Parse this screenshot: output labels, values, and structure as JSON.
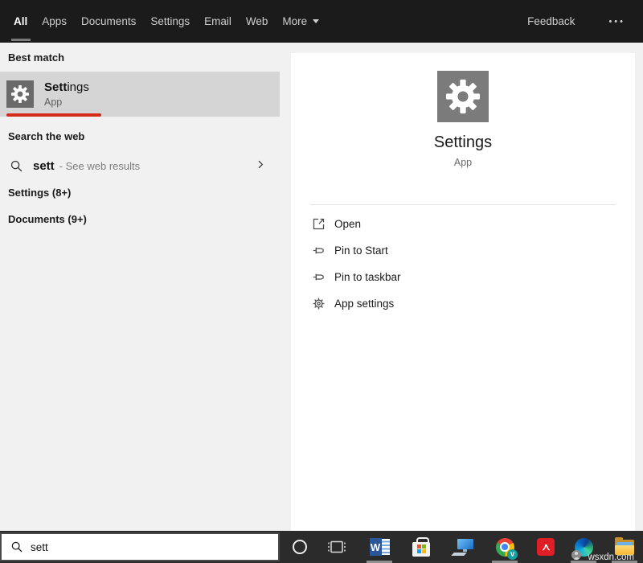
{
  "topbar": {
    "tabs": [
      {
        "label": "All",
        "active": true
      },
      {
        "label": "Apps",
        "active": false
      },
      {
        "label": "Documents",
        "active": false
      },
      {
        "label": "Settings",
        "active": false
      },
      {
        "label": "Email",
        "active": false
      },
      {
        "label": "Web",
        "active": false
      }
    ],
    "more_label": "More",
    "feedback_label": "Feedback",
    "overflow_label": "•••"
  },
  "left_panel": {
    "best_match_header": "Best match",
    "best_match": {
      "title_match": "Sett",
      "title_rest": "ings",
      "subtitle": "App"
    },
    "search_web_header": "Search the web",
    "web_suggestion": {
      "query": "sett",
      "suffix": "- See web results"
    },
    "groups": [
      {
        "label": "Settings (8+)"
      },
      {
        "label": "Documents (9+)"
      }
    ]
  },
  "preview_pane": {
    "app_title": "Settings",
    "app_subtitle": "App",
    "actions": [
      {
        "label": "Open",
        "icon": "open-icon"
      },
      {
        "label": "Pin to Start",
        "icon": "pin-icon"
      },
      {
        "label": "Pin to taskbar",
        "icon": "pin-icon"
      },
      {
        "label": "App settings",
        "icon": "gear-outline-icon"
      }
    ]
  },
  "taskbar": {
    "search_value": "sett",
    "icons": [
      "cortana",
      "task-view",
      "word",
      "microsoft-store",
      "pc",
      "chrome",
      "acrobat",
      "edge",
      "file-explorer"
    ],
    "watermark": "wsxdn.com"
  },
  "colors": {
    "topbar_bg": "#1b1b1b",
    "panel_bg": "#f1f1f1",
    "selected_row_bg": "#d5d5d5",
    "tile_gray": "#7b7b7b",
    "annotation_red": "#d62a1b",
    "taskbar_bg": "#2b2b2b"
  }
}
